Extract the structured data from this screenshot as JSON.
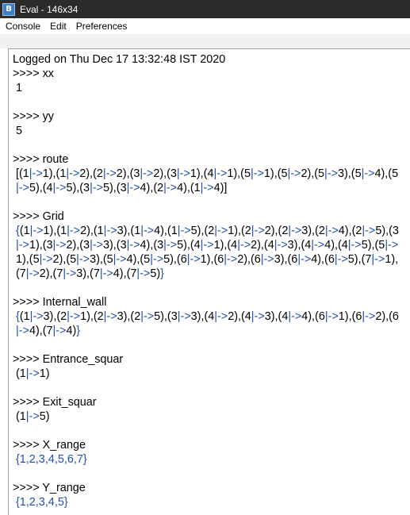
{
  "window": {
    "title": "Eval - 146x34",
    "icon": "app-logo-icon"
  },
  "menu": [
    "Console",
    "Edit",
    "Preferences"
  ],
  "console": {
    "log": "Logged on Thu Dec 17 13:32:48 IST 2020",
    "entries": [
      {
        "prompt": ">>>> xx",
        "result": "1",
        "style": "plain"
      },
      {
        "prompt": ">>>> yy",
        "result": "5",
        "style": "plain"
      },
      {
        "prompt": ">>>> route",
        "result": "[(1|->1),(1|->2),(2|->2),(3|->2),(3|->1),(4|->1),(5|->1),(5|->2),(5|->3),(5|->4),(5|->5),(4|->5),(3|->5),(3|->4),(2|->4),(1|->4)]",
        "style": "mixed"
      },
      {
        "prompt": ">>>> Grid",
        "result": "{(1|->1),(1|->2),(1|->3),(1|->4),(1|->5),(2|->1),(2|->2),(2|->3),(2|->4),(2|->5),(3|->1),(3|->2),(3|->3),(3|->4),(3|->5),(4|->1),(4|->2),(4|->3),(4|->4),(4|->5),(5|->1),(5|->2),(5|->3),(5|->4),(5|->5),(6|->1),(6|->2),(6|->3),(6|->4),(6|->5),(7|->1),(7|->2),(7|->3),(7|->4),(7|->5)}",
        "style": "mixed"
      },
      {
        "prompt": ">>>> Internal_wall",
        "result": "{(1|->3),(2|->1),(2|->3),(2|->5),(3|->3),(4|->2),(4|->3),(4|->4),(6|->1),(6|->2),(6|->4),(7|->4)}",
        "style": "mixed"
      },
      {
        "prompt": ">>>> Entrance_squar",
        "result": "(1|->1)",
        "style": "mixed"
      },
      {
        "prompt": ">>>> Exit_squar",
        "result": "(1|->5)",
        "style": "mixed"
      },
      {
        "prompt": ">>>> X_range",
        "result": "{1,2,3,4,5,6,7}",
        "style": "blue"
      },
      {
        "prompt": ">>>> Y_range",
        "result": "{1,2,3,4,5}",
        "style": "blue"
      }
    ]
  },
  "colors": {
    "titlebar": "#2b2b2b",
    "result_accent": "#1f4fb0"
  }
}
